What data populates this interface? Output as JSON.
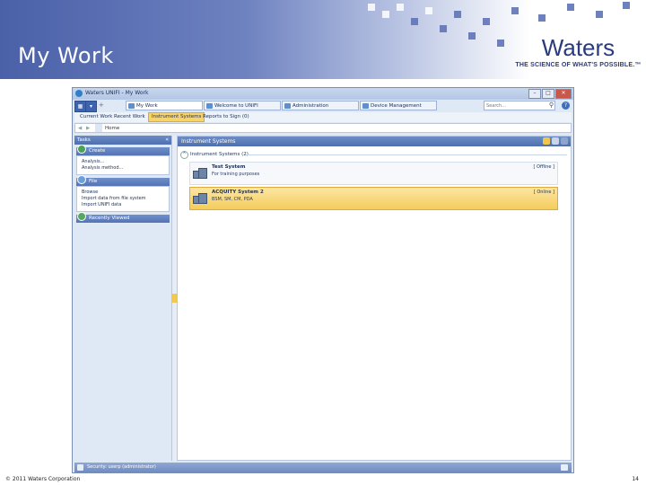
{
  "slide": {
    "title": "My Work",
    "logo_word": "Waters",
    "logo_tagline": "THE SCIENCE OF WHAT'S POSSIBLE.™",
    "footer": "© 2011 Waters Corporation",
    "page_number": "14"
  },
  "window": {
    "title": "Waters UNIFI - My Work",
    "controls": [
      "–",
      "□",
      "✕"
    ]
  },
  "tabs": [
    {
      "label": "My Work",
      "active": true
    },
    {
      "label": "Welcome to UNIFI",
      "active": false
    },
    {
      "label": "Administration",
      "active": false
    },
    {
      "label": "Device Management",
      "active": false
    }
  ],
  "search": {
    "placeholder": "Search..."
  },
  "subnav": {
    "items": [
      "Current Work",
      "Recent Work",
      "Instrument Systems",
      "Reports to Sign (0)"
    ],
    "active": "Instrument Systems"
  },
  "address": {
    "location": "Home"
  },
  "left_panel": {
    "header": "Tasks",
    "sections": [
      {
        "title": "Create",
        "items": [
          "Analysis...",
          "Analysis method..."
        ]
      },
      {
        "title": "File",
        "items": [
          "Browse",
          "Import data from file system",
          "Import UNIFI data"
        ]
      },
      {
        "title": "Recently Viewed",
        "items": []
      }
    ]
  },
  "main_panel": {
    "header": "Instrument Systems",
    "group_label": "Instrument Systems (2)",
    "systems": [
      {
        "name": "Test System",
        "description": "For training purposes",
        "status": "[ Offline ]",
        "selected": false
      },
      {
        "name": "ACQUITY System 2",
        "description": "BSM, SM, CM, PDA",
        "status": "[ Online ]",
        "selected": true
      }
    ]
  },
  "statusbar": {
    "user": "Security: userp (administrator)"
  },
  "colors": {
    "brand_blue": "#2a3b7e",
    "header_blue": "#4d6fb0",
    "highlight": "#f6cc5b"
  }
}
